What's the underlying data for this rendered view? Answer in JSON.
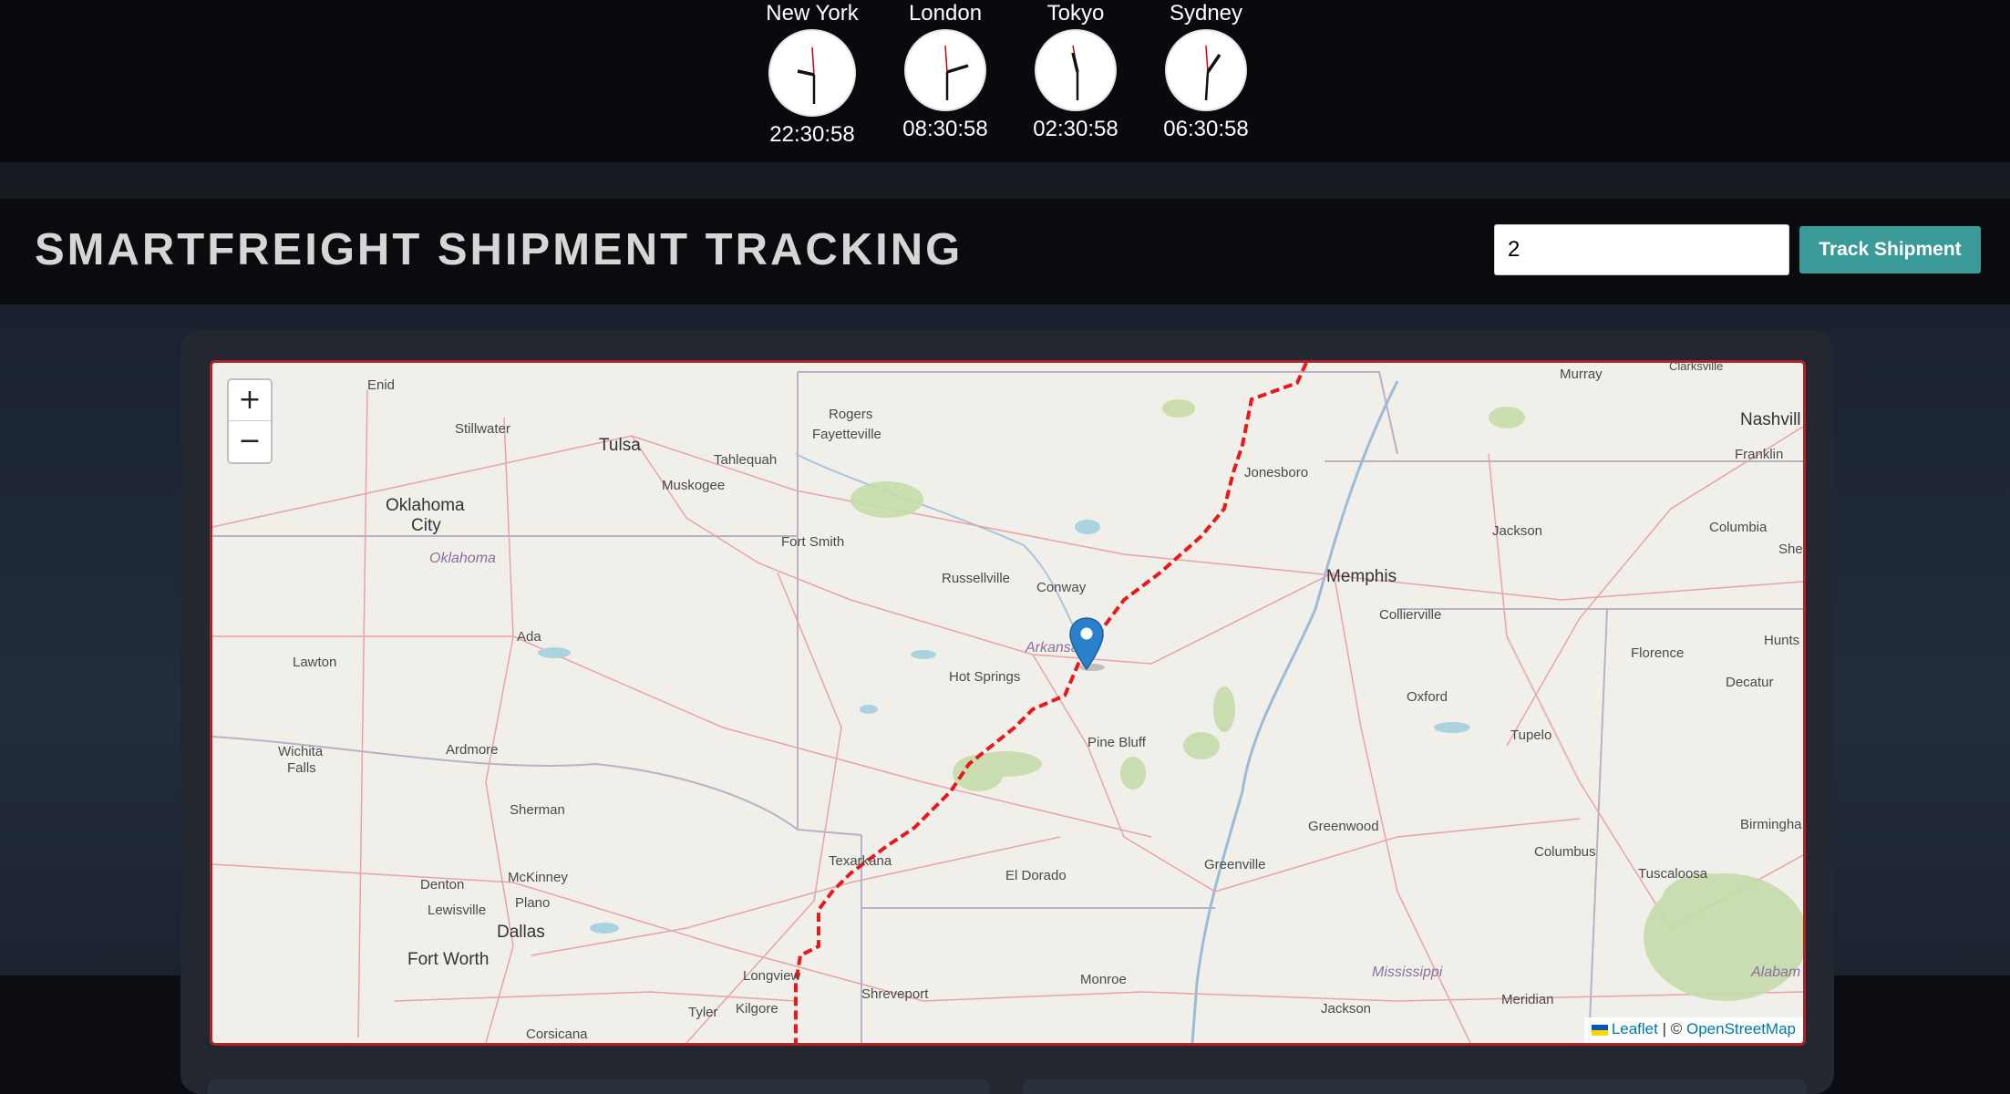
{
  "clocks": [
    {
      "city": "New York",
      "time": "22:30:58"
    },
    {
      "city": "London",
      "time": "08:30:58"
    },
    {
      "city": "Tokyo",
      "time": "02:30:58"
    },
    {
      "city": "Sydney",
      "time": "06:30:58"
    }
  ],
  "header": {
    "title": "SMARTFREIGHT SHIPMENT TRACKING",
    "input_value": "2",
    "button_label": "Track Shipment"
  },
  "map": {
    "zoom_in": "+",
    "zoom_out": "−",
    "attribution_leaflet": "Leaflet",
    "attribution_sep": " | © ",
    "attribution_osm": "OpenStreetMap",
    "route_color": "#e8191c",
    "marker_color": "#2a81cb",
    "labels": {
      "enid": "Enid",
      "stillwater": "Stillwater",
      "tulsa": "Tulsa",
      "tahlequah": "Tahlequah",
      "muskogee": "Muskogee",
      "rogers": "Rogers",
      "fayetteville": "Fayetteville",
      "okc1": "Oklahoma",
      "okc2": "City",
      "oklahoma_state": "Oklahoma",
      "fort_smith": "Fort Smith",
      "russellville": "Russellville",
      "conway": "Conway",
      "ada": "Ada",
      "lawton": "Lawton",
      "hot_springs": "Hot Springs",
      "arkansas_state": "Arkansas",
      "wichita1": "Wichita",
      "wichita2": "Falls",
      "ardmore": "Ardmore",
      "pine_bluff": "Pine Bluff",
      "sherman": "Sherman",
      "texarkana": "Texarkana",
      "el_dorado": "El Dorado",
      "denton": "Denton",
      "mckinney": "McKinney",
      "lewisville": "Lewisville",
      "plano": "Plano",
      "dallas": "Dallas",
      "fort_worth": "Fort Worth",
      "longview": "Longview",
      "shreveport": "Shreveport",
      "tyler": "Tyler",
      "kilgore": "Kilgore",
      "corsicana": "Corsicana",
      "monroe": "Monroe",
      "jonesboro": "Jonesboro",
      "memphis": "Memphis",
      "collierville": "Collierville",
      "oxford": "Oxford",
      "tupelo": "Tupelo",
      "greenwood": "Greenwood",
      "greenville": "Greenville",
      "columbus": "Columbus",
      "tuscaloosa": "Tuscaloosa",
      "mississippi_state": "Mississippi",
      "jackson_ms": "Jackson",
      "meridian": "Meridian",
      "alabama_state": "Alabam",
      "murray": "Murray",
      "clarksville": "Clarksville",
      "nashville": "Nashvill",
      "franklin": "Franklin",
      "jackson_tn": "Jackson",
      "columbia": "Columbia",
      "she": "She",
      "florence": "Florence",
      "decatur": "Decatur",
      "hunt": "Hunts",
      "birmingham": "Birmingha"
    }
  }
}
